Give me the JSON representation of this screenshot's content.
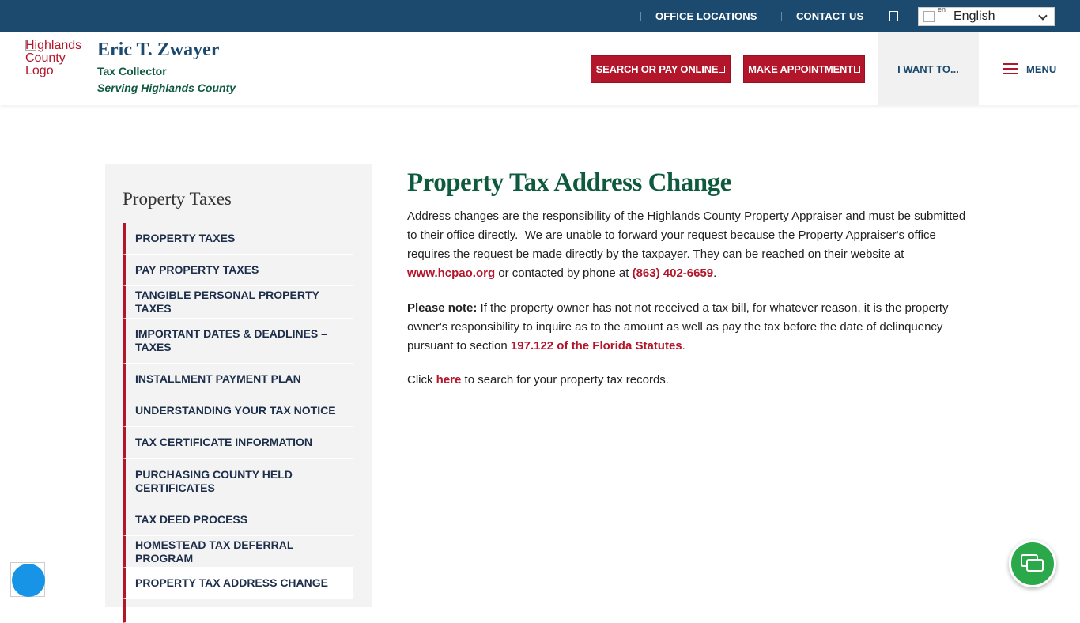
{
  "topbar": {
    "office_locations": "OFFICE LOCATIONS",
    "contact_us": "CONTACT US",
    "language": "English",
    "language_flag_alt": "en"
  },
  "header": {
    "logo_alt": "Highlands County Logo",
    "name": "Eric T. Zwayer",
    "title": "Tax Collector",
    "subtitle": "Serving Highlands County",
    "search_pay_button": "SEARCH OR PAY ONLINE",
    "appointment_button": "MAKE APPOINTMENT",
    "i_want_to": "I WANT TO...",
    "menu": "MENU"
  },
  "sidebar": {
    "title": "Property Taxes",
    "items": [
      {
        "label": "PROPERTY TAXES"
      },
      {
        "label": "PAY PROPERTY TAXES"
      },
      {
        "label": "TANGIBLE PERSONAL PROPERTY TAXES"
      },
      {
        "label": "IMPORTANT DATES & DEADLINES – TAXES"
      },
      {
        "label": "INSTALLMENT PAYMENT PLAN"
      },
      {
        "label": "UNDERSTANDING YOUR TAX NOTICE"
      },
      {
        "label": "TAX CERTIFICATE INFORMATION"
      },
      {
        "label": "PURCHASING COUNTY HELD CERTIFICATES"
      },
      {
        "label": "TAX DEED PROCESS"
      },
      {
        "label": "HOMESTEAD TAX DEFERRAL PROGRAM"
      },
      {
        "label": "PROPERTY TAX ADDRESS CHANGE"
      }
    ],
    "active_index": 10
  },
  "main": {
    "title": "Property Tax Address Change",
    "p1_text1": "Address changes are the responsibility of the Highlands County Property Appraiser and must be submitted to their office directly.",
    "p1_underlined": "We are unable to forward your request because the Property Appraiser's office requires the request be made directly by the taxpayer",
    "p1_text2": ".  They can be reached on their website at ",
    "p1_website": "www.hcpao.org",
    "p1_text3": " or contacted by phone at ",
    "p1_phone": "(863) 402-6659",
    "p1_end": ".",
    "p2_bold": "Please note:",
    "p2_text": " If the property owner has not not received a tax bill, for whatever reason, it is the property owner's responsibility to inquire as to the amount as well as pay the tax before the date of delinquency pursuant to section ",
    "p2_link": "197.122 of the Florida Statutes",
    "p2_end": ".",
    "p3_text1": "Click ",
    "p3_link": "here",
    "p3_text2": " to search for your property tax records."
  },
  "colors": {
    "topbar": "#1c4a6e",
    "brand_red": "#b3152a",
    "heading_green": "#0d5a3e",
    "chat_green": "#2aa84a",
    "accessibility_blue": "#1794e5"
  },
  "icons": {
    "office_locations": "map-marker-icon",
    "contact_us": "phone-icon",
    "search": "search-icon",
    "external": "external-link-icon",
    "menu": "hamburger-icon",
    "accessibility": "accessibility-icon",
    "chat": "chat-icon"
  }
}
